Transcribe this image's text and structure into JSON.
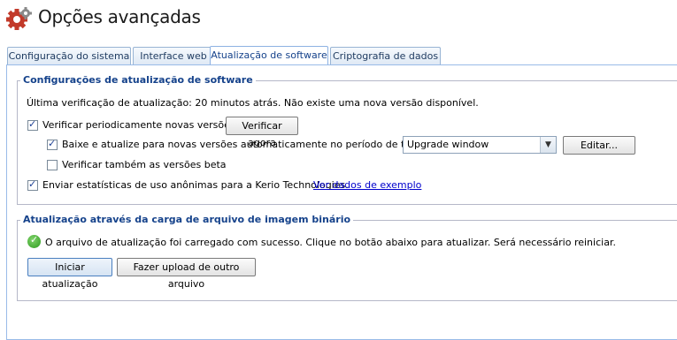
{
  "window": {
    "title": "Opções avançadas",
    "icon": "gear-icon"
  },
  "tabs": [
    {
      "label": "Configuração do sistema"
    },
    {
      "label": "Interface web"
    },
    {
      "label": "Atualização de software",
      "active": true
    },
    {
      "label": "Criptografia de dados"
    }
  ],
  "software_update": {
    "legend": "Configurações de atualização de software",
    "last_check": "Última verificação de atualização: 20 minutos atrás. Não existe uma nova versão disponível.",
    "periodic_check_label": "Verificar periodicamente novas versões",
    "periodic_check": true,
    "check_now_button": "Verificar agora",
    "auto_download_label": "Baixe e atualize para novas versões automaticamente no período de tempo:",
    "auto_download": true,
    "time_period_value": "Upgrade window",
    "edit_button": "Editar...",
    "beta_label": "Verificar também as versões beta",
    "beta": false,
    "stats_label": "Enviar estatísticas de uso anônimas para a Kerio Technologies.",
    "stats": true,
    "sample_link": "Ver dados de exemplo"
  },
  "binary_update": {
    "legend": "Atualização através da carga de arquivo de imagem binário",
    "status_message": "O arquivo de atualização foi carregado com sucesso. Clique no botão abaixo para atualizar. Será necessário reiniciar.",
    "start_button": "Iniciar atualização",
    "upload_other_button": "Fazer upload de outro arquivo"
  },
  "colors": {
    "accent": "#15428b",
    "tab_border": "#99bbe8",
    "success": "#2e9a1e"
  }
}
